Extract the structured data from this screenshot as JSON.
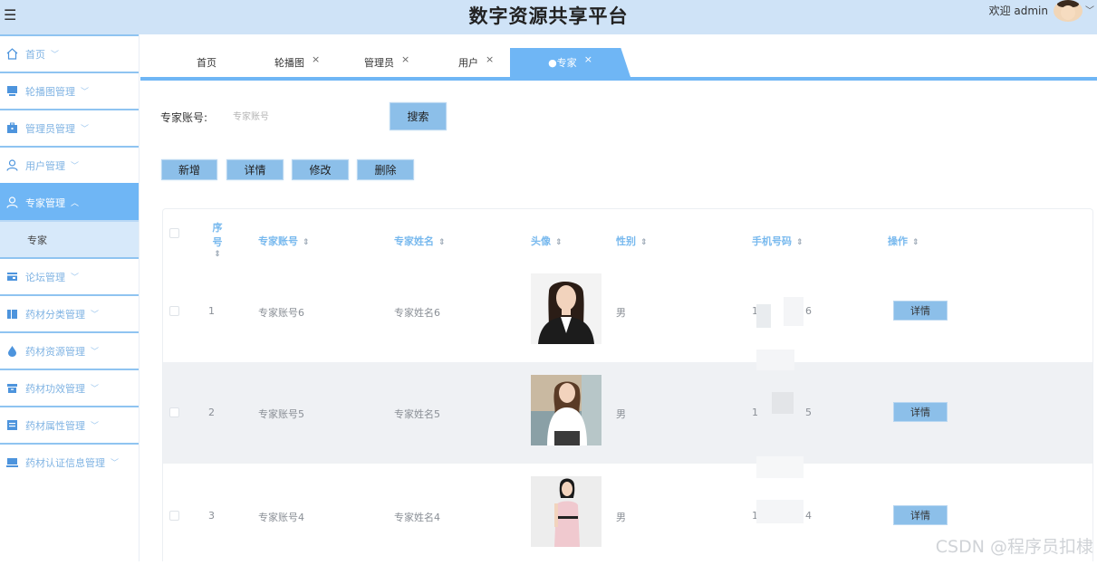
{
  "header": {
    "title": "数字资源共享平台",
    "welcome": "欢迎 admin",
    "menu_icon": "hamburger-icon"
  },
  "sidebar": {
    "items": [
      {
        "label": "首页",
        "icon": "home-icon"
      },
      {
        "label": "轮播图管理",
        "icon": "monitor-icon"
      },
      {
        "label": "管理员管理",
        "icon": "briefcase-icon"
      },
      {
        "label": "用户管理",
        "icon": "user-icon"
      },
      {
        "label": "专家管理",
        "icon": "user-icon",
        "active": true
      },
      {
        "label": "论坛管理",
        "icon": "card-icon"
      },
      {
        "label": "药材分类管理",
        "icon": "book-icon"
      },
      {
        "label": "药材资源管理",
        "icon": "drop-icon"
      },
      {
        "label": "药材功效管理",
        "icon": "box-icon"
      },
      {
        "label": "药材属性管理",
        "icon": "panel-icon"
      },
      {
        "label": "药材认证信息管理",
        "icon": "laptop-icon"
      }
    ],
    "sub_item": "专家"
  },
  "tabs": [
    {
      "label": "首页",
      "closable": false
    },
    {
      "label": "轮播图",
      "closable": true
    },
    {
      "label": "管理员",
      "closable": true
    },
    {
      "label": "用户",
      "closable": true
    },
    {
      "label": "●专家",
      "closable": true,
      "active": true
    }
  ],
  "tab_close_symbol": "×",
  "search": {
    "label": "专家账号:",
    "placeholder": "专家账号",
    "button": "搜索"
  },
  "actions": {
    "add": "新增",
    "detail": "详情",
    "edit": "修改",
    "delete": "删除"
  },
  "table": {
    "columns": [
      "序号",
      "专家账号",
      "专家姓名",
      "头像",
      "性别",
      "手机号码",
      "操作"
    ],
    "rows": [
      {
        "index": "1",
        "account": "专家账号6",
        "name": "专家姓名6",
        "gender": "男",
        "phone_first": "1",
        "phone_last": "6",
        "action": "详情"
      },
      {
        "index": "2",
        "account": "专家账号5",
        "name": "专家姓名5",
        "gender": "男",
        "phone_first": "1",
        "phone_last": "5",
        "action": "详情"
      },
      {
        "index": "3",
        "account": "专家账号4",
        "name": "专家姓名4",
        "gender": "男",
        "phone_first": "1",
        "phone_last": "4",
        "action": "详情"
      }
    ]
  },
  "watermark": "CSDN @程序员扣棣",
  "colors": {
    "accent": "#6fb6f5",
    "button": "#8cbfe9",
    "header_bg": "#cfe3f7",
    "column_header": "#78b9ee"
  }
}
